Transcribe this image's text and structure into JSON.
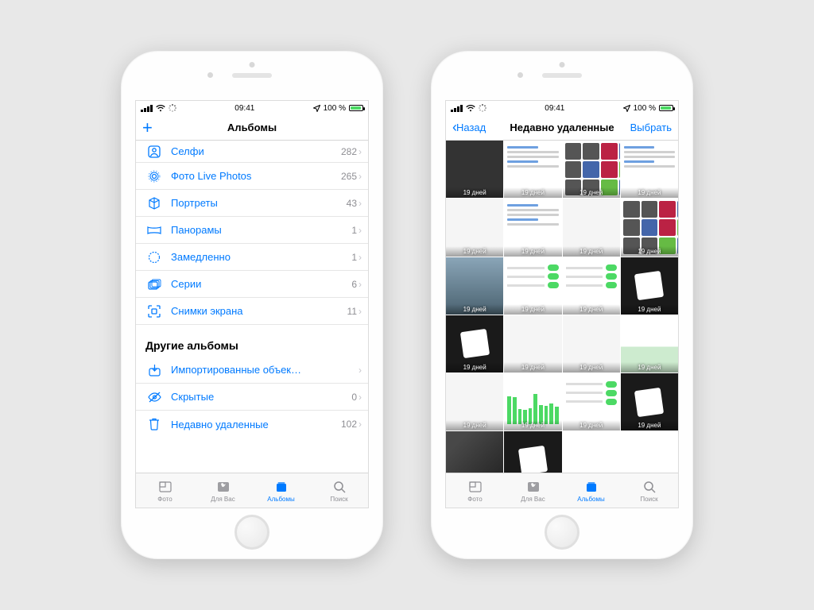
{
  "status": {
    "time": "09:41",
    "battery": "100 %"
  },
  "left": {
    "title": "Альбомы",
    "rows": [
      {
        "icon": "selfie",
        "label": "Селфи",
        "count": "282"
      },
      {
        "icon": "live",
        "label": "Фото Live Photos",
        "count": "265"
      },
      {
        "icon": "cube",
        "label": "Портреты",
        "count": "43"
      },
      {
        "icon": "pano",
        "label": "Панорамы",
        "count": "1"
      },
      {
        "icon": "slomo",
        "label": "Замедленно",
        "count": "1"
      },
      {
        "icon": "burst",
        "label": "Серии",
        "count": "6"
      },
      {
        "icon": "screenshot",
        "label": "Снимки экрана",
        "count": "11"
      }
    ],
    "otherHeader": "Другие альбомы",
    "other": [
      {
        "icon": "import",
        "label": "Импортированные объек…",
        "count": ""
      },
      {
        "icon": "hidden",
        "label": "Скрытые",
        "count": "0"
      },
      {
        "icon": "trash",
        "label": "Недавно удаленные",
        "count": "102"
      }
    ]
  },
  "right": {
    "back": "Назад",
    "title": "Недавно удаленные",
    "select": "Выбрать",
    "days": "19 дней"
  },
  "tabs": [
    {
      "label": "Фото"
    },
    {
      "label": "Для Вас"
    },
    {
      "label": "Альбомы"
    },
    {
      "label": "Поиск"
    }
  ]
}
